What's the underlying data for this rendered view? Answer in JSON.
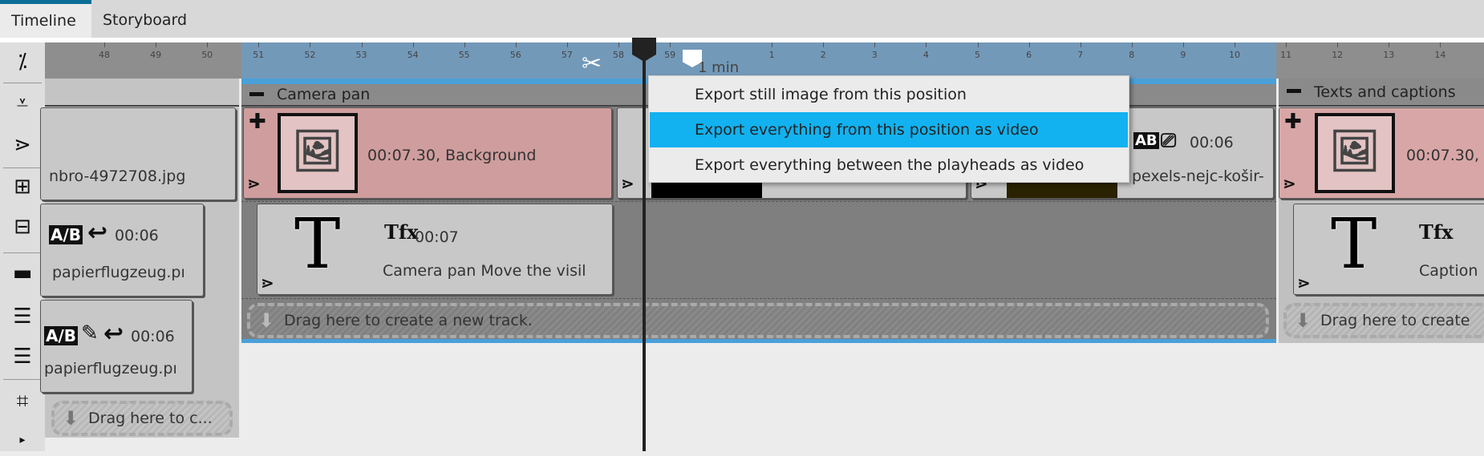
{
  "tabs": [
    {
      "label": "Timeline",
      "active": true
    },
    {
      "label": "Storyboard",
      "active": false
    }
  ],
  "toolbar": {
    "icons": [
      "split-icon",
      "insert-marker-icon",
      "effects-icon",
      "add-track-icon",
      "remove-track-icon",
      "filmstrip-icon",
      "align-left-icon",
      "align-center-icon",
      "fit-window-icon"
    ]
  },
  "ruler": {
    "ticks_left": [
      "48",
      "49",
      "50",
      "51",
      "52",
      "53",
      "54",
      "55",
      "56",
      "57",
      "58",
      "59"
    ],
    "minute_label": "1 min",
    "ticks_right": [
      "1",
      "2",
      "3",
      "4",
      "5",
      "6",
      "7",
      "8",
      "9",
      "10",
      "11",
      "12",
      "13",
      "14"
    ]
  },
  "groups": {
    "left": {
      "clip1_name": "nbro-4972708.jpg",
      "clip2_duration": "00:06",
      "clip2_name": "papierflugzeug.pı",
      "clip3_duration": "00:06",
      "clip3_name": "papierflugzeug.pı",
      "drag_label": "Drag here to c..."
    },
    "camera": {
      "title": "Camera pan",
      "clip1_label": "00:07.30, Background",
      "clip3_duration": "00:06",
      "clip3_name": "pexels-nejc-košir-",
      "text_clip_duration": "00:07",
      "text_clip_label": "Camera pan Move the visil",
      "drag_label": "Drag here to create a new track."
    },
    "texts": {
      "title": "Texts and captions",
      "clip1_label": "00:07.30,",
      "text_clip_label": "Caption",
      "drag_label": "Drag here to create"
    }
  },
  "context_menu": {
    "items": [
      {
        "label": "Export still image from this position",
        "highlighted": false
      },
      {
        "label": "Export everything from this position as video",
        "highlighted": true
      },
      {
        "label": "Export everything between the playheads as video",
        "highlighted": false
      }
    ]
  },
  "colors": {
    "accent": "#12b2f0",
    "ruler_selection": "#7399b9",
    "clip_pink": "#cf9d9d",
    "tab_indicator": "#0c6e96"
  }
}
